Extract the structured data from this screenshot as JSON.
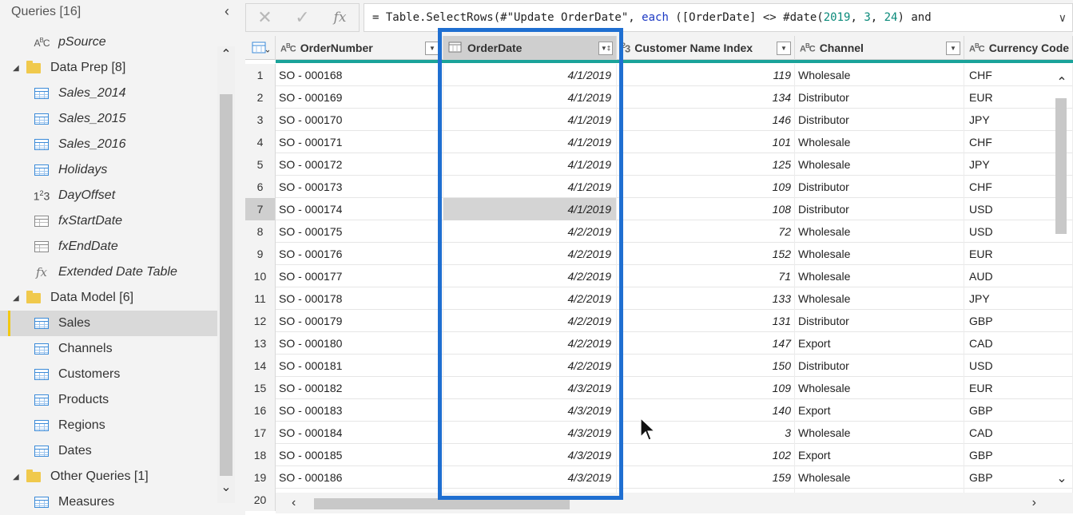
{
  "queries": {
    "header": "Queries [16]",
    "items": [
      {
        "label": "pSource",
        "kind": "text",
        "level": "child",
        "italic": true
      },
      {
        "label": "Data Prep [8]",
        "kind": "folder",
        "level": "folder"
      },
      {
        "label": "Sales_2014",
        "kind": "table",
        "level": "child",
        "italic": true
      },
      {
        "label": "Sales_2015",
        "kind": "table",
        "level": "child",
        "italic": true
      },
      {
        "label": "Sales_2016",
        "kind": "table",
        "level": "child",
        "italic": true
      },
      {
        "label": "Holidays",
        "kind": "table",
        "level": "child",
        "italic": true
      },
      {
        "label": "DayOffset",
        "kind": "number",
        "level": "child",
        "italic": true
      },
      {
        "label": "fxStartDate",
        "kind": "fntable",
        "level": "child",
        "italic": true
      },
      {
        "label": "fxEndDate",
        "kind": "fntable",
        "level": "child",
        "italic": true
      },
      {
        "label": "Extended Date Table",
        "kind": "fx",
        "level": "child",
        "italic": true
      },
      {
        "label": "Data Model [6]",
        "kind": "folder",
        "level": "folder"
      },
      {
        "label": "Sales",
        "kind": "table",
        "level": "child",
        "selected": true
      },
      {
        "label": "Channels",
        "kind": "table",
        "level": "child"
      },
      {
        "label": "Customers",
        "kind": "table",
        "level": "child"
      },
      {
        "label": "Products",
        "kind": "table",
        "level": "child"
      },
      {
        "label": "Regions",
        "kind": "table",
        "level": "child"
      },
      {
        "label": "Dates",
        "kind": "table",
        "level": "child"
      },
      {
        "label": "Other Queries [1]",
        "kind": "folder",
        "level": "folder"
      },
      {
        "label": "Measures",
        "kind": "table",
        "level": "child"
      }
    ]
  },
  "formula": {
    "cancel_glyph": "✕",
    "commit_glyph": "✓",
    "fx_glyph": "fx",
    "prefix": "= Table.SelectRows(#\"Update OrderDate\", ",
    "kw_each": "each",
    "mid": " ([OrderDate] <> #date(",
    "n1": "2019",
    "sep1": ", ",
    "n2": "3",
    "sep2": ", ",
    "n3": "24",
    "suffix": ") and"
  },
  "grid": {
    "columns": [
      {
        "name": "OrderNumber",
        "type": "ABC"
      },
      {
        "name": "OrderDate",
        "type": ""
      },
      {
        "name": "Customer Name Index",
        "type": "23"
      },
      {
        "name": "Channel",
        "type": "ABC"
      },
      {
        "name": "Currency Code",
        "type": "ABC"
      }
    ],
    "rows": [
      [
        "1",
        "SO - 000168",
        "4/1/2019",
        "119",
        "Wholesale",
        "CHF"
      ],
      [
        "2",
        "SO - 000169",
        "4/1/2019",
        "134",
        "Distributor",
        "EUR"
      ],
      [
        "3",
        "SO - 000170",
        "4/1/2019",
        "146",
        "Distributor",
        "JPY"
      ],
      [
        "4",
        "SO - 000171",
        "4/1/2019",
        "101",
        "Wholesale",
        "CHF"
      ],
      [
        "5",
        "SO - 000172",
        "4/1/2019",
        "125",
        "Wholesale",
        "JPY"
      ],
      [
        "6",
        "SO - 000173",
        "4/1/2019",
        "109",
        "Distributor",
        "CHF"
      ],
      [
        "7",
        "SO - 000174",
        "4/1/2019",
        "108",
        "Distributor",
        "USD"
      ],
      [
        "8",
        "SO - 000175",
        "4/2/2019",
        "72",
        "Wholesale",
        "USD"
      ],
      [
        "9",
        "SO - 000176",
        "4/2/2019",
        "152",
        "Wholesale",
        "EUR"
      ],
      [
        "10",
        "SO - 000177",
        "4/2/2019",
        "71",
        "Wholesale",
        "AUD"
      ],
      [
        "11",
        "SO - 000178",
        "4/2/2019",
        "133",
        "Wholesale",
        "JPY"
      ],
      [
        "12",
        "SO - 000179",
        "4/2/2019",
        "131",
        "Distributor",
        "GBP"
      ],
      [
        "13",
        "SO - 000180",
        "4/2/2019",
        "147",
        "Export",
        "CAD"
      ],
      [
        "14",
        "SO - 000181",
        "4/2/2019",
        "150",
        "Distributor",
        "USD"
      ],
      [
        "15",
        "SO - 000182",
        "4/3/2019",
        "109",
        "Wholesale",
        "EUR"
      ],
      [
        "16",
        "SO - 000183",
        "4/3/2019",
        "140",
        "Export",
        "GBP"
      ],
      [
        "17",
        "SO - 000184",
        "4/3/2019",
        "3",
        "Wholesale",
        "CAD"
      ],
      [
        "18",
        "SO - 000185",
        "4/3/2019",
        "102",
        "Export",
        "GBP"
      ],
      [
        "19",
        "SO - 000186",
        "4/3/2019",
        "159",
        "Wholesale",
        "GBP"
      ],
      [
        "20",
        "",
        "",
        "",
        "",
        ""
      ]
    ],
    "selected_row": "7",
    "selected_column": "OrderDate"
  },
  "colors": {
    "highlight": "#1f6fd1",
    "quality_bar": "#1aa39a",
    "folder": "#f0c94c",
    "selected_accent": "#f2c811"
  }
}
